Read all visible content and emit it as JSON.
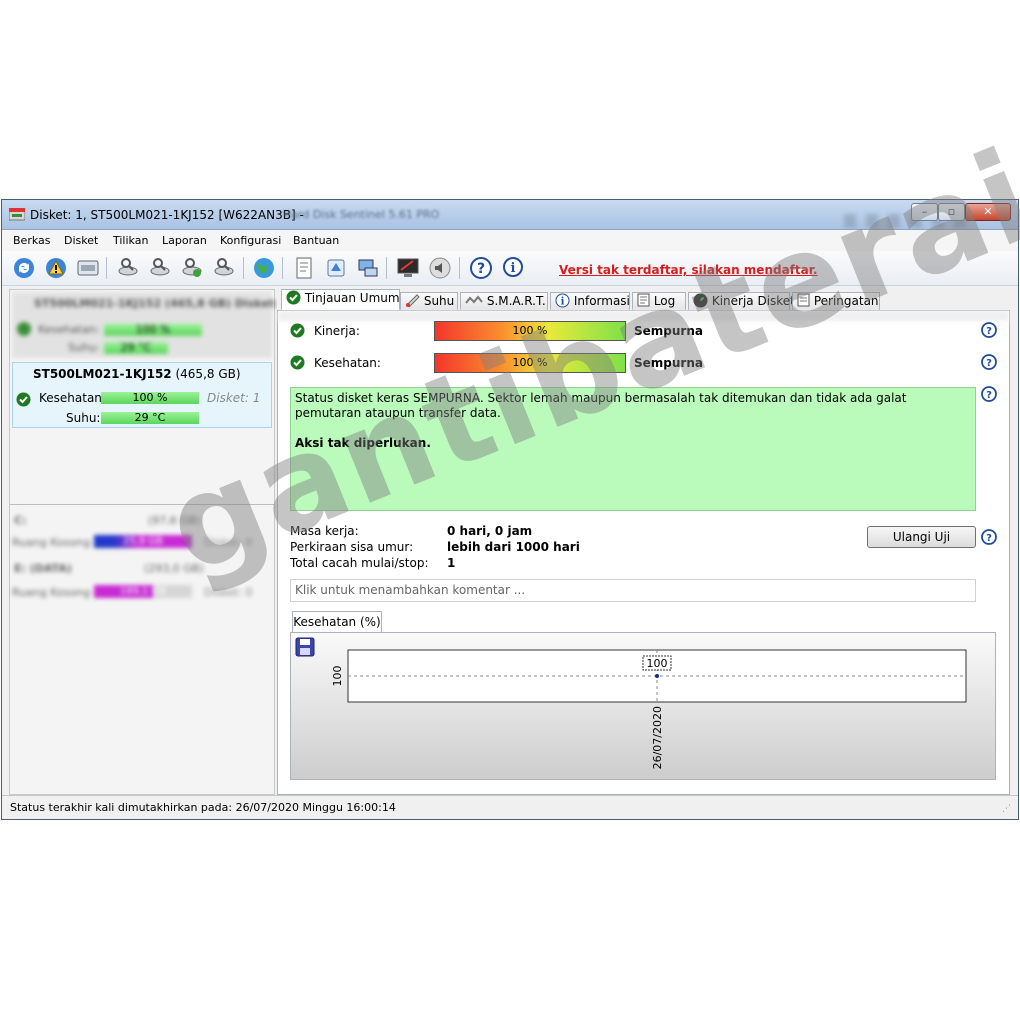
{
  "window": {
    "title": "Disket: 1, ST500LM021-1KJ152 [W622AN3B]  -",
    "app_name": "Hard Disk Sentinel 5.61 PRO"
  },
  "menu": [
    "Berkas",
    "Disket",
    "Tilikan",
    "Laporan",
    "Konfigurasi",
    "Bantuan"
  ],
  "toolbar": {
    "unregistered_notice": "Versi tak terdaftar, silakan mendaftar.",
    "icons": [
      "refresh-icon",
      "alert-icon",
      "disk-icon",
      "test-icon",
      "test-icon",
      "test-icon",
      "test-icon",
      "globe-icon",
      "report-icon",
      "send-icon",
      "network-icon",
      "monitor-icon",
      "sound-icon",
      "help-icon",
      "info-icon"
    ]
  },
  "left_panel": {
    "blurred_disk": {
      "header": "ST500LM021-1KJ152 (465,8 GB)  Disket: 0",
      "health_label": "Kesehatan:",
      "health_value": "100 %",
      "temp_label": "Suhu:",
      "temp_value": "29 °C"
    },
    "selected_disk": {
      "name": "ST500LM021-1KJ152",
      "size": "(465,8 GB)",
      "health_label": "Kesehatan:",
      "health_value": "100 %",
      "disk_no": "Disket: 1",
      "temp_label": "Suhu:",
      "temp_value": "29 °C"
    },
    "volumes": [
      {
        "name": "C:",
        "size": "(97,6 GB)",
        "free_label": "Ruang Kosong",
        "free_value": "25,9 GB",
        "disk_no": "Disket: 0"
      },
      {
        "name": "E: (DATA)",
        "size": "(293,0 GB)",
        "free_label": "Ruang Kosong",
        "free_value": "189,1 GB",
        "disk_no": "Disket: 0"
      }
    ]
  },
  "tabs": [
    {
      "label": "Tinjauan Umum",
      "icon": "check-icon",
      "active": true
    },
    {
      "label": "Suhu",
      "icon": "thermometer-icon"
    },
    {
      "label": "S.M.A.R.T.",
      "icon": "smart-icon"
    },
    {
      "label": "Informasi",
      "icon": "info-icon"
    },
    {
      "label": "Log",
      "icon": "log-icon"
    },
    {
      "label": "Kinerja Disket",
      "icon": "gauge-icon"
    },
    {
      "label": "Peringatan",
      "icon": "warning-doc-icon"
    }
  ],
  "overview": {
    "performance_label": "Kinerja:",
    "performance_value": "100 %",
    "performance_fraction": 1.0,
    "performance_status": "Sempurna",
    "health_label": "Kesehatan:",
    "health_value": "100 %",
    "health_fraction": 1.0,
    "health_status": "Sempurna",
    "status_text": "Status disket keras SEMPURNA. Sektor lemah maupun bermasalah tak ditemukan dan tidak ada galat pemutaran ataupun transfer data.",
    "action_text": "Aksi tak diperlukan.",
    "power_on_label": "Masa kerja:",
    "power_on_value": "0 hari, 0 jam",
    "lifetime_label": "Perkiraan sisa umur:",
    "lifetime_value": "lebih dari 1000 hari",
    "start_stop_label": "Total cacah mulai/stop:",
    "start_stop_value": "1",
    "retest_button": "Ulangi Uji",
    "comment_placeholder": "Klik untuk menambahkan komentar ..."
  },
  "chart_tab": "Kesehatan (%)",
  "chart_data": {
    "type": "line",
    "x": [
      "26/07/2020"
    ],
    "values": [
      100
    ],
    "ylim": [
      100,
      100
    ]
  },
  "status_bar": "Status terakhir kali dimutakhirkan pada: 26/07/2020 Minggu 16:00:14",
  "watermark": "gantibaterai"
}
